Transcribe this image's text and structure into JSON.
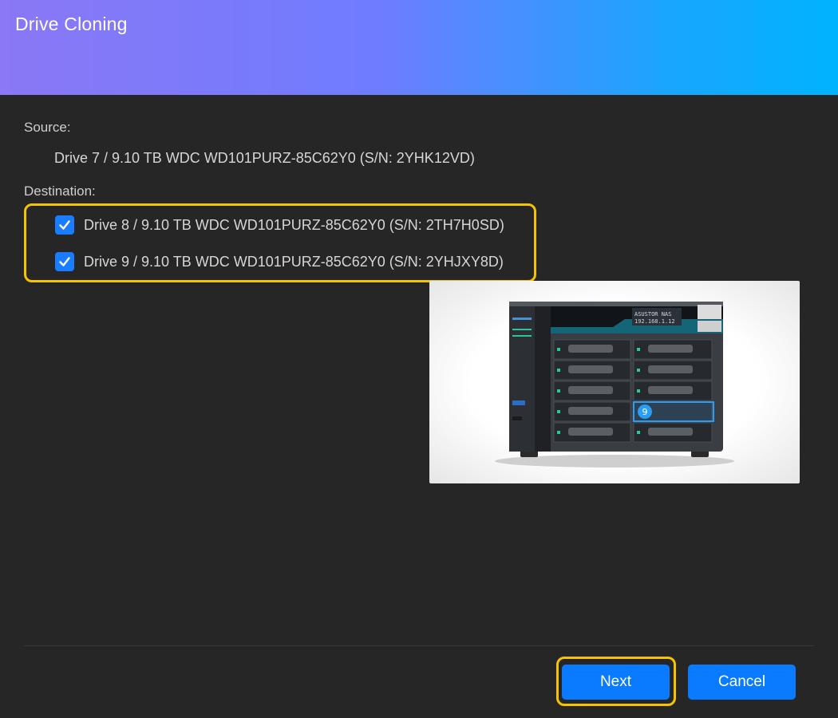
{
  "dialog": {
    "title": "Drive Cloning"
  },
  "source": {
    "label": "Source:",
    "value": "Drive 7 / 9.10 TB WDC WD101PURZ-85C62Y0 (S/N: 2YHK12VD)"
  },
  "destination": {
    "label": "Destination:",
    "items": [
      {
        "text": "Drive 8 / 9.10 TB WDC WD101PURZ-85C62Y0 (S/N: 2TH7H0SD)",
        "checked": true
      },
      {
        "text": "Drive 9 / 9.10 TB WDC WD101PURZ-85C62Y0 (S/N: 2YHJXY8D)",
        "checked": true
      }
    ]
  },
  "preview": {
    "highlighted_bay": "9",
    "lcd_line1": "ASUSTOR NAS",
    "lcd_line2": "192.168.1.12"
  },
  "buttons": {
    "next": "Next",
    "cancel": "Cancel"
  },
  "colors": {
    "accent": "#0a7bff",
    "focus": "#f5c400",
    "background": "#262626",
    "highlight": "#2a9df4"
  }
}
